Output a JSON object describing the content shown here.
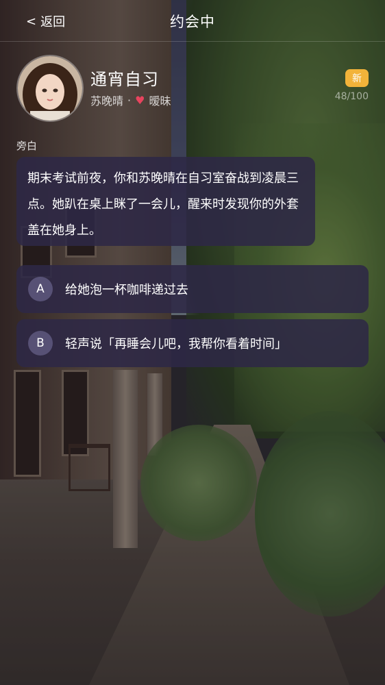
{
  "header": {
    "back_label": "返回",
    "title": "约会中"
  },
  "profile": {
    "scene_title": "通宵自习",
    "character_name": "苏晚晴",
    "separator": "·",
    "relationship": "暧昧",
    "badge": "新",
    "progress_text": "48/100"
  },
  "narration": {
    "label": "旁白",
    "text": "期末考试前夜，你和苏晚晴在自习室奋战到凌晨三点。她趴在桌上眯了一会儿，醒来时发现你的外套盖在她身上。"
  },
  "choices": [
    {
      "letter": "A",
      "text": "给她泡一杯咖啡递过去"
    },
    {
      "letter": "B",
      "text": "轻声说「再睡会儿吧，我帮你看着时间」"
    }
  ],
  "colors": {
    "badge": "#f2b33a",
    "heart": "#e8445e",
    "card_bg": "#2d2846"
  },
  "icons": {
    "back": "chevron-left-icon",
    "relationship": "heart-icon"
  }
}
